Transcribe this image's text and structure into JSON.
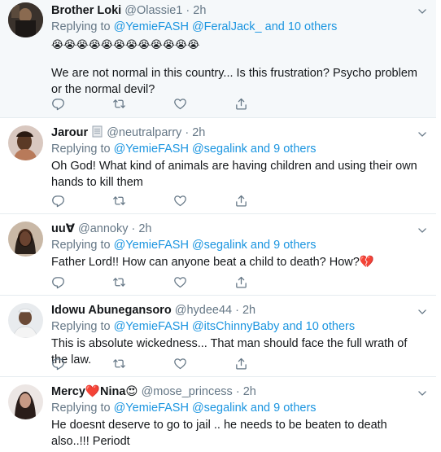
{
  "tweets": [
    {
      "name": "Brother Loki",
      "handle": "@Olassie1",
      "time": "2h",
      "reply_prefix": "Replying to ",
      "reply_mentions": "@YemieFASH @FeralJack_",
      "reply_others": " and 10 others",
      "emoji_line": "😭😭😭😭😭😭😭😭😭😭😭😭",
      "text": "We are not normal in this country... Is this frustration? Psycho problem or the normal devil?"
    },
    {
      "name": "Jarour",
      "handle": "@neutralparry",
      "time": "2h",
      "reply_prefix": "Replying to ",
      "reply_mentions": "@YemieFASH @segalink",
      "reply_others": " and 9 others",
      "text": "Oh God! What kind of animals are having children and using their own hands to kill them"
    },
    {
      "name": "uu∀",
      "handle": "@annoky",
      "time": "2h",
      "reply_prefix": "Replying to ",
      "reply_mentions": "@YemieFASH @segalink",
      "reply_others": " and 9 others",
      "text": "Father Lord!! How can anyone beat a child to death? How?💔"
    },
    {
      "name": "Idowu Abunegansoro",
      "handle": "@hydee44",
      "time": "2h",
      "reply_prefix": "Replying to ",
      "reply_mentions": "@YemieFASH @itsChinnyBaby",
      "reply_others": " and 10 others",
      "text": "This is absolute wickedness... That man should face the full wrath of the law."
    },
    {
      "name_part1": "Mercy",
      "name_heart": "❤️",
      "name_part2": "Nina",
      "name_emoji": "😍",
      "handle": "@mose_princess",
      "time": "2h",
      "reply_prefix": "Replying to ",
      "reply_mentions": "@YemieFASH @segalink",
      "reply_others": " and 9 others",
      "text": "He doesnt deserve to go to jail .. he needs to be beaten to death also..!!! Periodt"
    }
  ],
  "separator": "·",
  "colors": {
    "link": "#1b95e0",
    "muted": "#657786",
    "text": "#14171a",
    "highlight_bg": "#f5f8fa",
    "border": "#e6ecf0"
  },
  "icons": [
    "reply-icon",
    "retweet-icon",
    "like-icon",
    "share-icon",
    "chevron-down-icon",
    "document-badge-icon"
  ]
}
